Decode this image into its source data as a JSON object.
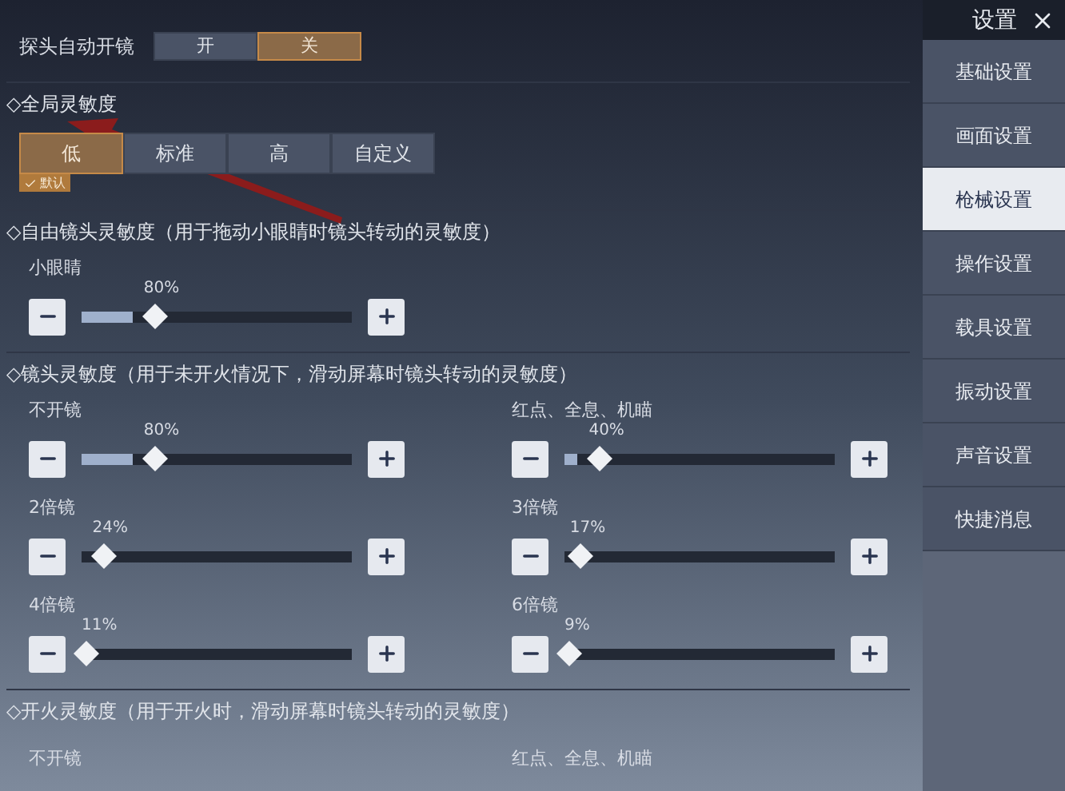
{
  "header": {
    "title": "设置"
  },
  "probe": {
    "label": "探头自动开镜",
    "options": [
      {
        "label": "开",
        "selected": false
      },
      {
        "label": "关",
        "selected": true
      }
    ]
  },
  "global": {
    "title": "◇全局灵敏度",
    "options": [
      {
        "label": "低",
        "selected": true
      },
      {
        "label": "标准",
        "selected": false
      },
      {
        "label": "高",
        "selected": false
      },
      {
        "label": "自定义",
        "selected": false
      }
    ],
    "default_tag": "默认"
  },
  "sections": [
    {
      "title": "◇自由镜头灵敏度（用于拖动小眼睛时镜头转动的灵敏度）",
      "items": [
        {
          "kind": "slider",
          "label": "小眼睛",
          "reading": "80%",
          "level": 0.27
        }
      ]
    },
    {
      "title": "◇镜头灵敏度（用于未开火情况下，滑动屏幕时镜头转动的灵敏度）",
      "items": [
        {
          "kind": "slider",
          "label": "不开镜",
          "reading": "80%",
          "level": 0.27
        },
        {
          "kind": "slider",
          "label": "红点、全息、机瞄",
          "reading": "40%",
          "level": 0.13
        },
        {
          "kind": "slider",
          "label": "2倍镜",
          "reading": "24%",
          "level": 0.08
        },
        {
          "kind": "slider",
          "label": "3倍镜",
          "reading": "17%",
          "level": 0.06
        },
        {
          "kind": "slider",
          "label": "4倍镜",
          "reading": "11%",
          "level": 0.02
        },
        {
          "kind": "slider",
          "label": "6倍镜",
          "reading": "9%",
          "level": 0.02
        }
      ]
    },
    {
      "title": "◇开火灵敏度（用于开火时，滑动屏幕时镜头转动的灵敏度）",
      "items": [
        {
          "kind": "label",
          "label": "不开镜"
        },
        {
          "kind": "label",
          "label": "红点、全息、机瞄"
        }
      ]
    }
  ],
  "sidebar": {
    "items": [
      {
        "label": "基础设置",
        "selected": false
      },
      {
        "label": "画面设置",
        "selected": false
      },
      {
        "label": "枪械设置",
        "selected": true
      },
      {
        "label": "操作设置",
        "selected": false
      },
      {
        "label": "载具设置",
        "selected": false
      },
      {
        "label": "振动设置",
        "selected": false
      },
      {
        "label": "声音设置",
        "selected": false
      },
      {
        "label": "快捷消息",
        "selected": false
      }
    ]
  }
}
